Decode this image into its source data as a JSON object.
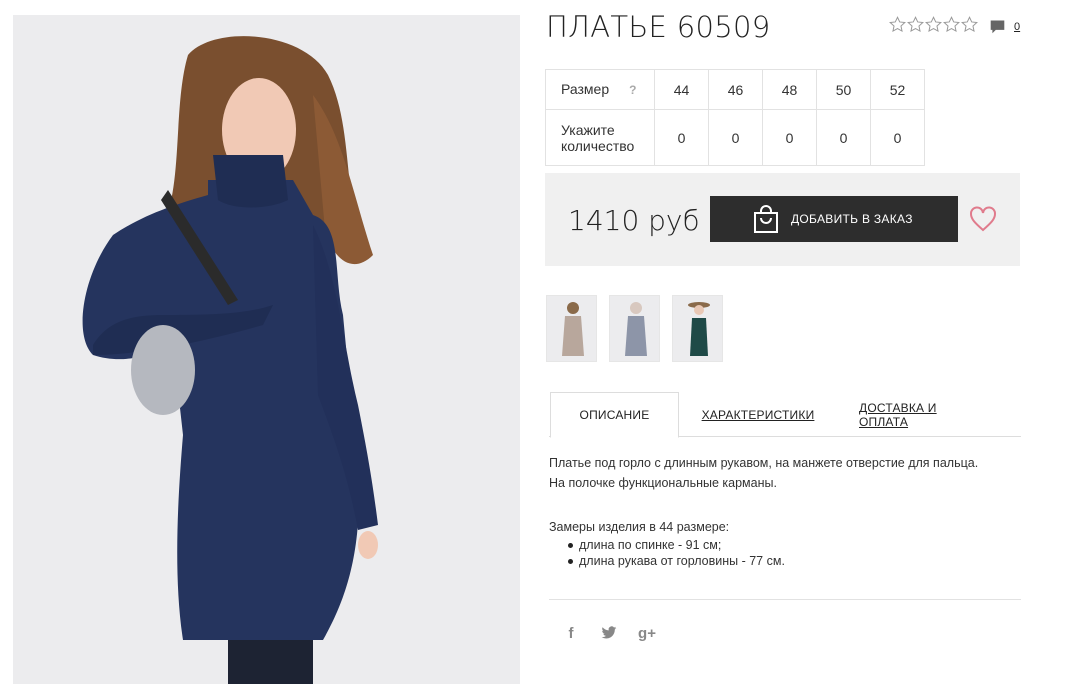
{
  "product": {
    "title": "ПЛАТЬЕ 60509",
    "rating": 0,
    "max_rating": 5,
    "comment_count": "0"
  },
  "sizes": {
    "size_label": "Размер",
    "help_label": "?",
    "qty_label_line1": "Укажите",
    "qty_label_line2": "количество",
    "values": [
      "44",
      "46",
      "48",
      "50",
      "52"
    ],
    "quantities": [
      "0",
      "0",
      "0",
      "0",
      "0"
    ]
  },
  "purchase": {
    "price": "1410 руб",
    "add_button": "ДОБАВИТЬ В ЗАКАЗ",
    "icon": "shopping-bag-icon"
  },
  "thumbnails": [
    {
      "color": "#b8a79c"
    },
    {
      "color": "#8d95a8"
    },
    {
      "color": "#1f4a47"
    }
  ],
  "tabs": [
    {
      "label": "ОПИСАНИЕ",
      "active": true
    },
    {
      "label": "ХАРАКТЕРИСТИКИ",
      "active": false
    },
    {
      "label": "ДОСТАВКА И ОПЛАТА",
      "active": false
    }
  ],
  "description": {
    "line1": "Платье под горло с длинным рукавом, на манжете отверстие для пальца.",
    "line2": "На полочке функциональные карманы.",
    "measures_title": "Замеры изделия в 44 размере:",
    "measures": [
      "длина по спинке - 91 см;",
      "длина рукава от горловины - 77 см."
    ]
  },
  "share": {
    "facebook": "f",
    "twitter": "twitter-icon",
    "google": "g+"
  },
  "colors": {
    "dress": "#25345e",
    "button": "#2d2d2d",
    "heart": "#e07b8c",
    "price_bg": "#f0f0f0"
  }
}
